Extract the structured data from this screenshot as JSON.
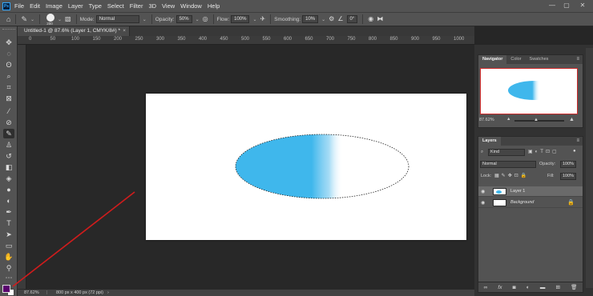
{
  "app": {
    "logo": "Ps",
    "menu": [
      "File",
      "Edit",
      "Image",
      "Layer",
      "Type",
      "Select",
      "Filter",
      "3D",
      "View",
      "Window",
      "Help"
    ],
    "window_controls": {
      "minimize": "—",
      "maximize": "▢",
      "close": "✕"
    }
  },
  "options": {
    "brush_size": "200",
    "mode_label": "Mode:",
    "mode_value": "Normal",
    "opacity_label": "Opacity:",
    "opacity_value": "50%",
    "flow_label": "Flow:",
    "flow_value": "100%",
    "smoothing_label": "Smoothing:",
    "smoothing_value": "10%",
    "angle_value": "0°"
  },
  "document": {
    "tab_title": "Untitled-1 @ 87.6% (Layer 1, CMYK/8#) *",
    "close": "×"
  },
  "ruler": {
    "marks": [
      "0",
      "50",
      "100",
      "150",
      "200",
      "250",
      "300",
      "350",
      "400",
      "450",
      "500",
      "550",
      "600",
      "650",
      "700",
      "750",
      "800",
      "850",
      "900",
      "950",
      "1000"
    ]
  },
  "status": {
    "zoom": "87.62%",
    "doc_info": "800 px x 400 px (72 ppi)"
  },
  "colors": {
    "foreground": "#5a006e",
    "background": "#ffffff",
    "brush_blue": "#3fb7ec",
    "annotation_red": "#d01c1c"
  },
  "navigator": {
    "tabs": [
      "Navigator",
      "Color",
      "Swatches"
    ],
    "zoom": "87.62%",
    "menu_icon": "≡"
  },
  "layers": {
    "tab": "Layers",
    "menu_icon": "≡",
    "filter_kind": "Kind",
    "blend_mode": "Normal",
    "opacity_label": "Opacity:",
    "opacity_value": "100%",
    "lock_label": "Lock:",
    "fill_label": "Fill:",
    "fill_value": "100%",
    "items": [
      {
        "name": "Layer 1",
        "selected": true
      },
      {
        "name": "Background",
        "selected": false
      }
    ],
    "footer_icons": [
      "link-icon",
      "fx-icon",
      "mask-icon",
      "adjustment-icon",
      "group-icon",
      "new-layer-icon",
      "trash-icon"
    ]
  }
}
